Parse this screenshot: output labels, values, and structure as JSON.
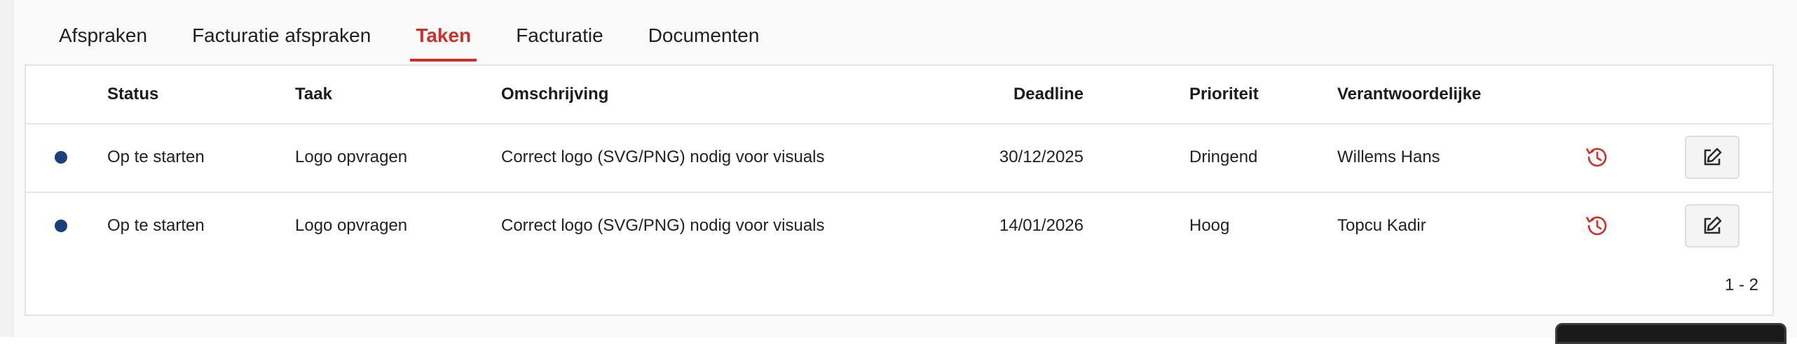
{
  "tabs": [
    {
      "label": "Afspraken"
    },
    {
      "label": "Facturatie afspraken"
    },
    {
      "label": "Taken"
    },
    {
      "label": "Facturatie"
    },
    {
      "label": "Documenten"
    }
  ],
  "active_tab": "Taken",
  "table": {
    "columns": {
      "status": "Status",
      "taak": "Taak",
      "omschrijving": "Omschrijving",
      "deadline": "Deadline",
      "prioriteit": "Prioriteit",
      "verantwoordelijke": "Verantwoordelijke"
    },
    "rows": [
      {
        "status": "Op te starten",
        "taak": "Logo opvragen",
        "omschrijving": "Correct logo (SVG/PNG) nodig voor visuals",
        "deadline": "30/12/2025",
        "prioriteit": "Dringend",
        "verantwoordelijke": "Willems Hans"
      },
      {
        "status": "Op te starten",
        "taak": "Logo opvragen",
        "omschrijving": "Correct logo (SVG/PNG) nodig voor visuals",
        "deadline": "14/01/2026",
        "prioriteit": "Hoog",
        "verantwoordelijke": "Topcu Kadir"
      }
    ],
    "pagination": "1 - 2"
  },
  "icons": {
    "status_dot": "status-dot-icon",
    "history": "history-clock-icon",
    "edit": "edit-pencil-icon"
  },
  "colors": {
    "accent": "#cf2f2a",
    "status_dot": "#1a3f7e"
  }
}
